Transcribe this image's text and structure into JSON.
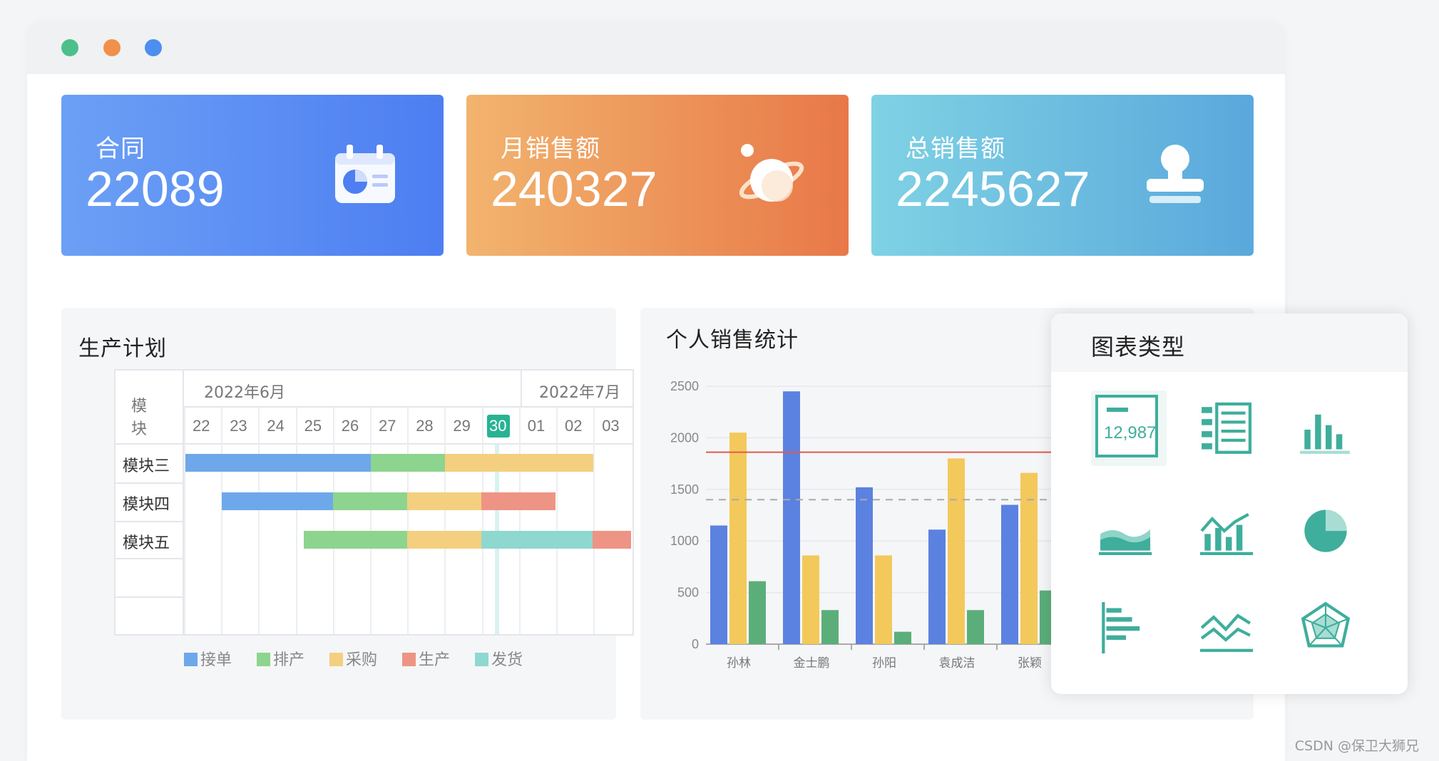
{
  "window": {
    "dots": [
      "#4cc08a",
      "#f0904a",
      "#4d8ef0"
    ]
  },
  "cards": [
    {
      "label": "合同",
      "value": "22089",
      "icon": "calendar-icon",
      "gradient": [
        "#6ca0f5",
        "#4d7ef2"
      ]
    },
    {
      "label": "月销售额",
      "value": "240327",
      "icon": "planet-icon",
      "gradient": [
        "#f2b46e",
        "#e87848"
      ]
    },
    {
      "label": "总销售额",
      "value": "2245627",
      "icon": "stamp-icon",
      "gradient": [
        "#7fd2e4",
        "#5aa8dc"
      ]
    }
  ],
  "production": {
    "title": "生产计划",
    "module_header": [
      "模",
      "块"
    ],
    "month1": "2022年6月",
    "month2": "2022年7月",
    "days": [
      "22",
      "23",
      "24",
      "25",
      "26",
      "27",
      "28",
      "29",
      "30",
      "01",
      "02",
      "03"
    ],
    "highlight_day": "30",
    "modules": [
      "模块三",
      "模块四",
      "模块五"
    ],
    "legend": [
      {
        "name": "接单",
        "color": "#6ea8ea"
      },
      {
        "name": "排产",
        "color": "#8dd48e"
      },
      {
        "name": "采购",
        "color": "#f4cf7f"
      },
      {
        "name": "生产",
        "color": "#ee9484"
      },
      {
        "name": "发货",
        "color": "#8ed8cf"
      }
    ]
  },
  "sales": {
    "title": "个人销售统计"
  },
  "chart_data": {
    "type": "bar",
    "categories": [
      "孙林",
      "金士鹏",
      "孙阳",
      "袁成洁",
      "张颖"
    ],
    "series": [
      {
        "color": "#5b82e0",
        "values": [
          1150,
          2450,
          1520,
          1110,
          1350
        ]
      },
      {
        "color": "#f3c95c",
        "values": [
          2050,
          860,
          860,
          1800,
          1660
        ]
      },
      {
        "color": "#5bae7a",
        "values": [
          610,
          330,
          120,
          330,
          520
        ]
      }
    ],
    "ylim": [
      0,
      2500
    ],
    "yticks": [
      "0",
      "500",
      "1000",
      "1500",
      "2000",
      "2500"
    ],
    "reference_lines": [
      {
        "value": 1860,
        "style": "solid",
        "color": "#e05a4a"
      },
      {
        "value": 1400,
        "style": "dashed",
        "color": "#aaaaaa"
      }
    ],
    "grid": true
  },
  "chart_types": {
    "title": "图表类型",
    "indicator_value": "12,987",
    "items": [
      "indicator-card-icon",
      "list-table-icon",
      "column-chart-icon",
      "area-chart-icon",
      "combo-chart-icon",
      "pie-chart-icon",
      "bar-chart-icon",
      "line-chart-icon",
      "radar-chart-icon"
    ]
  },
  "watermark": "CSDN @保卫大狮兄"
}
